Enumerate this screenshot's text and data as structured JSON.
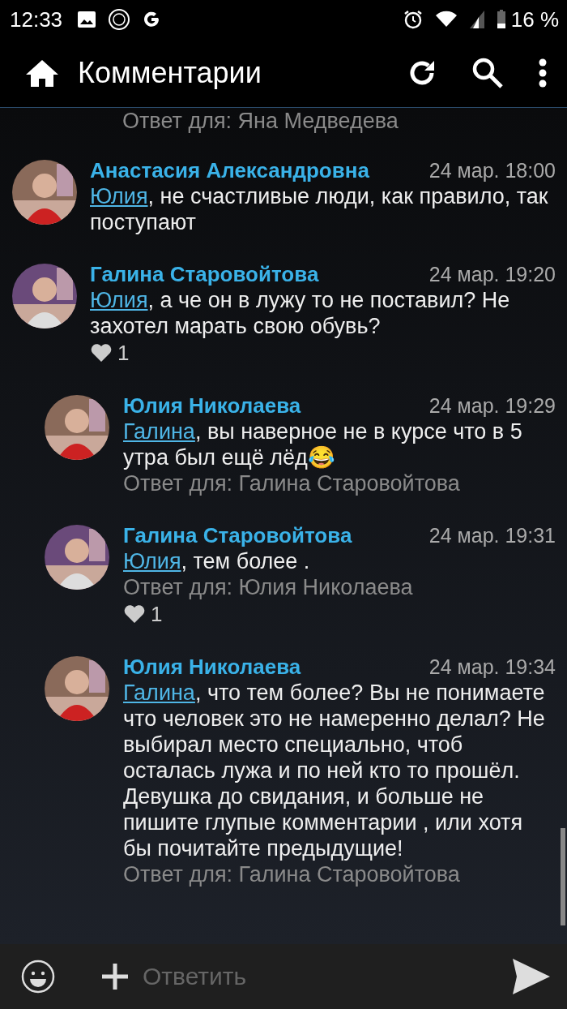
{
  "status_bar": {
    "time": "12:33",
    "battery": "16 %"
  },
  "toolbar": {
    "title": "Комментарии"
  },
  "comments": [
    {
      "reply_to": "Ответ для: Яна Медведева"
    },
    {
      "author": "Анастасия Александровна",
      "date": "24 мар. 18:00",
      "mention": "Юлия",
      "text": ", не счастливые люди, как правило, так поступают"
    },
    {
      "author": "Галина Старовойтова",
      "date": "24 мар. 19:20",
      "mention": "Юлия",
      "text": ", а че он в лужу то не поставил? Не захотел марать свою обувь?",
      "likes": "1",
      "children": [
        {
          "author": "Юлия Николаева",
          "date": "24 мар. 19:29",
          "mention": "Галина",
          "text": ", вы наверное не в курсе что в 5 утра был ещё лёд😂",
          "reply_to": "Ответ для: Галина Старовойтова"
        },
        {
          "author": "Галина Старовойтова",
          "date": "24 мар. 19:31",
          "mention": "Юлия",
          "text": ", тем более .",
          "reply_to": "Ответ для: Юлия Николаева",
          "likes": "1"
        },
        {
          "author": "Юлия Николаева",
          "date": "24 мар. 19:34",
          "mention": "Галина",
          "text": ", что тем более? Вы не понимаете что человек это не намеренно делал? Не выбирал место специально, чтоб осталась лужа и по ней кто то прошёл. Девушка до свидания, и больше не пишите глупые комментарии , или хотя бы почитайте предыдущие!",
          "reply_to": "Ответ для: Галина Старовойтова"
        }
      ]
    }
  ],
  "composer": {
    "placeholder": "Ответить"
  }
}
